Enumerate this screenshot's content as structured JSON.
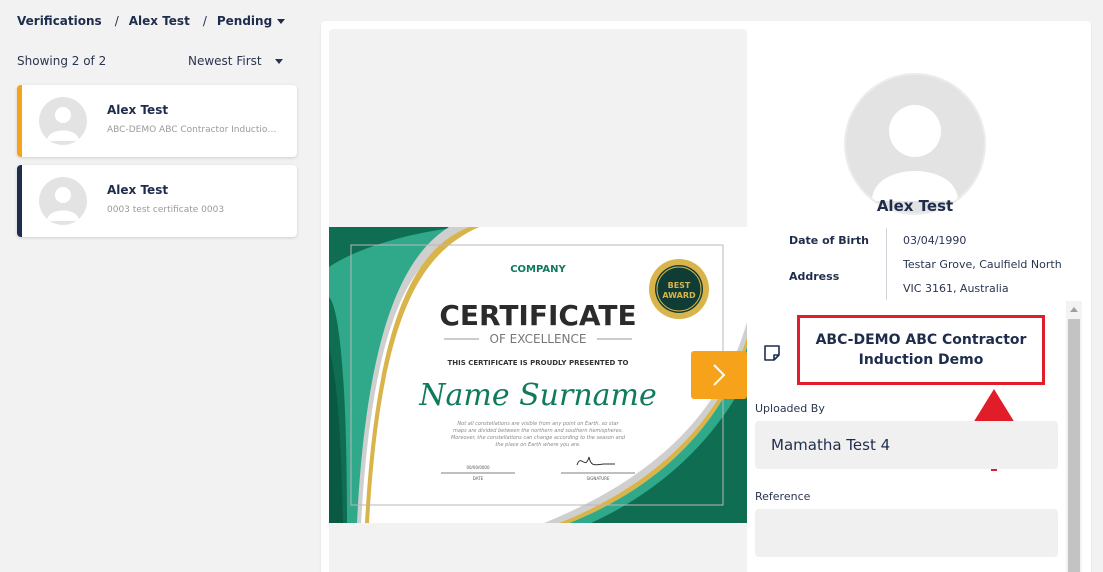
{
  "breadcrumb": {
    "item1": "Verifications",
    "item2": "Alex Test",
    "item3": "Pending",
    "separator": "/"
  },
  "list": {
    "showing": "Showing 2 of 2",
    "sort": "Newest First",
    "items": [
      {
        "name": "Alex Test",
        "subtitle": "ABC-DEMO ABC Contractor Induction Demo",
        "accent": "#f7a21b"
      },
      {
        "name": "Alex Test",
        "subtitle": "0003 test certificate 0003",
        "accent": "#1f2d4d"
      }
    ]
  },
  "certificate": {
    "company": "COMPANY",
    "title": "CERTIFICATE",
    "subtitle": "OF EXCELLENCE",
    "presented": "THIS CERTIFICATE IS PROUDLY PRESENTED TO",
    "recipient": "Name Surname",
    "body_line1": "Not all constellations are visible from any point on Earth, so star",
    "body_line2": "maps are divided between the northern and southern hemispheres.",
    "body_line3": "Moreover, the constellations can change according to the season and",
    "body_line4": "the place on Earth where you are.",
    "date_value": "00/00/0000",
    "date_label": "DATE",
    "signature_label": "SIGNATURE",
    "badge_line1": "BEST",
    "badge_line2": "AWARD"
  },
  "details": {
    "name": "Alex Test",
    "dob_label": "Date of Birth",
    "dob": "03/04/1990",
    "address_label": "Address",
    "address_line1": "Testar Grove, Caulfield North",
    "address_line2": "VIC 3161, Australia",
    "document_title": "ABC-DEMO ABC Contractor Induction Demo",
    "uploaded_by_label": "Uploaded By",
    "uploaded_by": "Mamatha Test 4",
    "reference_label": "Reference",
    "reference": ""
  },
  "colors": {
    "navy": "#1f2d4d",
    "orange": "#f7a21b",
    "highlight_red": "#e11d2a",
    "green": "#0f7a5c"
  }
}
